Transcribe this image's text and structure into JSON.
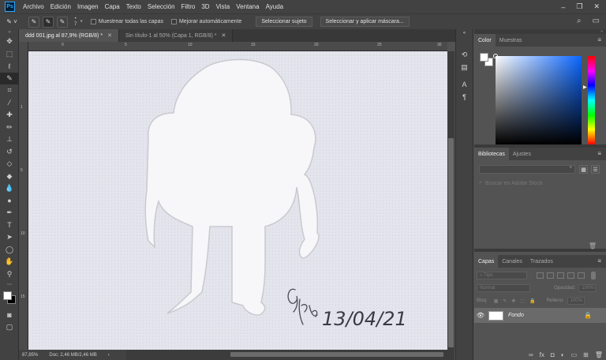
{
  "menubar": {
    "logo": "Ps",
    "items": [
      "Archivo",
      "Edición",
      "Imagen",
      "Capa",
      "Texto",
      "Selección",
      "Filtro",
      "3D",
      "Vista",
      "Ventana",
      "Ayuda"
    ]
  },
  "options": {
    "brush_size": "7",
    "sample_all_layers": "Muestrear todas las capas",
    "auto_enhance": "Mejorar automáticamente",
    "select_subject": "Seleccionar sujeto",
    "select_and_mask": "Seleccionar y aplicar máscara..."
  },
  "tabs": [
    {
      "label": "ddd 001.jpg al 87,9% (RGB/8) *",
      "active": true
    },
    {
      "label": "Sin título-1 al 50% (Capa 1, RGB/8) *",
      "active": false
    }
  ],
  "ruler": {
    "top": [
      "0",
      "5",
      "10",
      "15",
      "20",
      "25",
      "30"
    ],
    "left": [
      "1",
      "5",
      "10",
      "15"
    ]
  },
  "canvas": {
    "signature_date": "13/04/21"
  },
  "status": {
    "zoom": "87,85%",
    "doc": "Doc: 2,46 MB/2,46 MB"
  },
  "color_panel": {
    "tabs": [
      "Color",
      "Muestras"
    ],
    "fg_color": "#ffffff",
    "bg_color": "#ffffff"
  },
  "libraries_panel": {
    "tabs": [
      "Bibliotecas",
      "Ajustes"
    ],
    "search_placeholder": "Buscar en Adobe Stock"
  },
  "layers_panel": {
    "tabs": [
      "Capas",
      "Canales",
      "Trazados"
    ],
    "filter_label": "Tipo",
    "blend_mode": "Normal",
    "opacity_label": "Opacidad:",
    "opacity_value": "100%",
    "lock_label": "Bloq:",
    "fill_label": "Relleno:",
    "fill_value": "100%",
    "layer_name": "Fondo"
  }
}
